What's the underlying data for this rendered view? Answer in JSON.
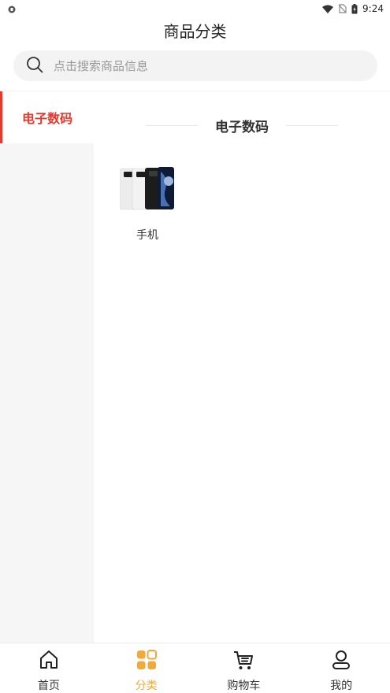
{
  "status_bar": {
    "time": "9:24"
  },
  "header": {
    "title": "商品分类"
  },
  "search": {
    "placeholder": "点击搜索商品信息"
  },
  "sidebar": {
    "items": [
      {
        "label": "电子数码",
        "active": true
      }
    ]
  },
  "section": {
    "title": "电子数码"
  },
  "products": [
    {
      "name": "手机",
      "icon": "phone-product-image"
    }
  ],
  "tabbar": {
    "tabs": [
      {
        "label": "首页",
        "icon": "home-icon",
        "active": false
      },
      {
        "label": "分类",
        "icon": "category-icon",
        "active": true
      },
      {
        "label": "购物车",
        "icon": "cart-icon",
        "active": false
      },
      {
        "label": "我的",
        "icon": "user-icon",
        "active": false
      }
    ]
  },
  "colors": {
    "accent_red": "#e23a2e",
    "accent_orange": "#f0a93b",
    "sidebar_bg": "#f6f6f6",
    "search_bg": "#f3f3f3"
  }
}
